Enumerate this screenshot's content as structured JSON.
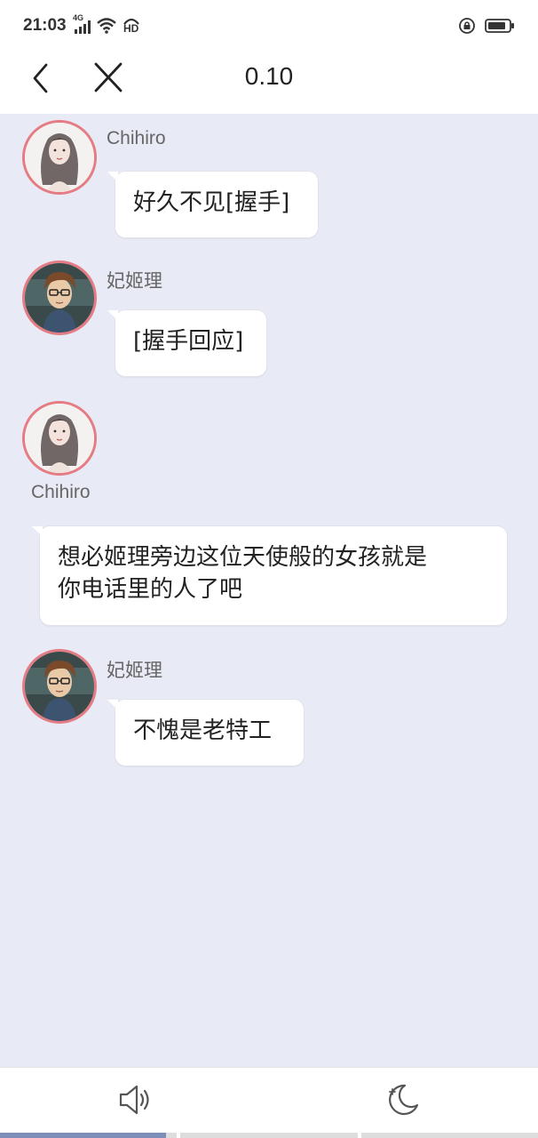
{
  "status_bar": {
    "time": "21:03",
    "network_label": "4G",
    "hd_label": "HD",
    "icons": [
      "signal-icon",
      "wifi-icon",
      "hd-call-icon",
      "screen-lock-icon",
      "battery-icon"
    ]
  },
  "header": {
    "title": "0.10",
    "back_icon": "chevron-left-icon",
    "close_icon": "close-icon"
  },
  "messages": [
    {
      "speaker": "Chihiro",
      "text": "好久不见[握手]",
      "avatar": "woman-avatar"
    },
    {
      "speaker": "妃姬理",
      "text": "[握手回应]",
      "avatar": "man-glasses-avatar"
    },
    {
      "speaker": "Chihiro",
      "text": "想必姬理旁边这位天使般的女孩就是你电话里的人了吧",
      "line1": "想必姬理旁边这位天使般的女孩就是",
      "line2": "你电话里的人了吧",
      "avatar": "woman-avatar"
    },
    {
      "speaker": "妃姬理",
      "text": "不愧是老特工",
      "avatar": "man-glasses-avatar"
    }
  ],
  "bottom_bar": {
    "sound_icon": "speaker-icon",
    "night_icon": "moon-icon",
    "progress_segments": 3,
    "progress_fraction": 0.31
  },
  "colors": {
    "chat_background": "#e8eaf6",
    "avatar_border": "#e57c84",
    "progress_fill": "#7d8fb8"
  }
}
